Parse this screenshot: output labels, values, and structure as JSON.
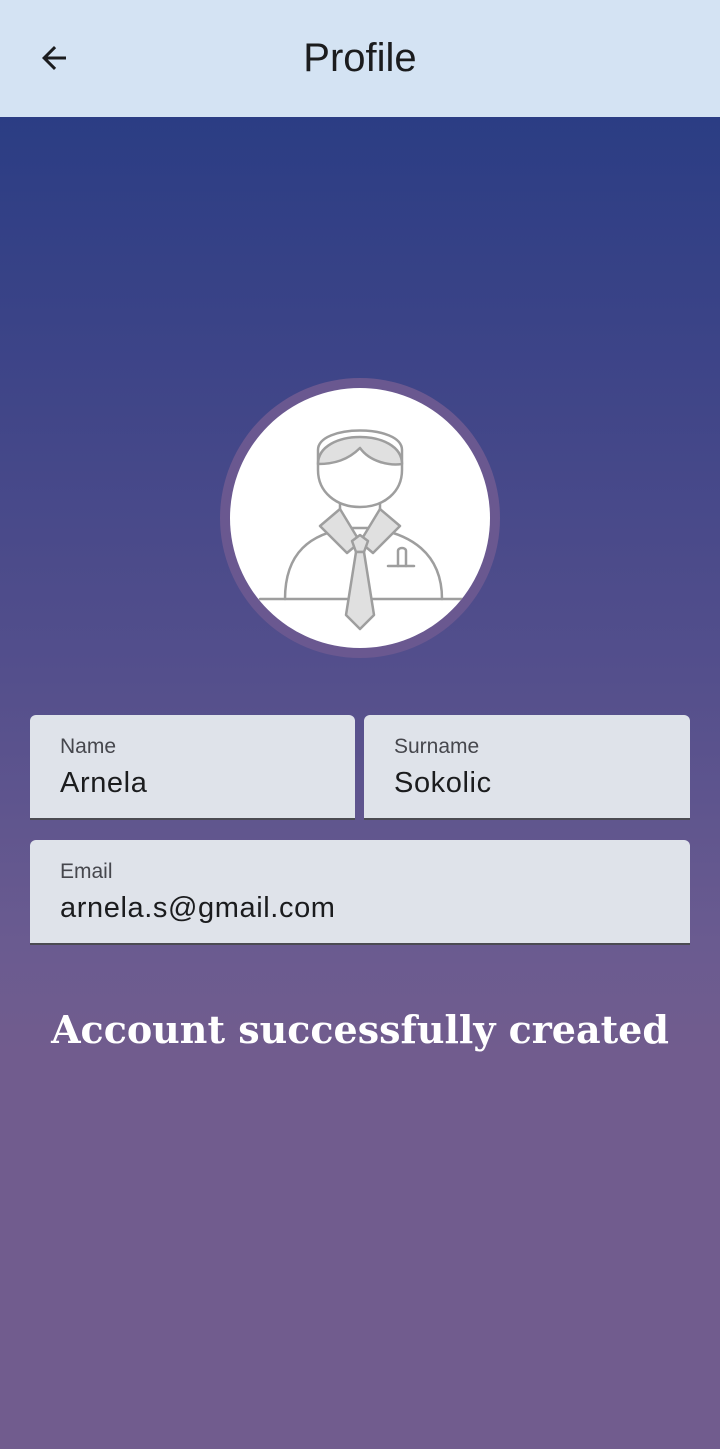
{
  "header": {
    "title": "Profile",
    "back_icon": "arrow-back-icon"
  },
  "profile": {
    "avatar_icon": "person-with-tie-icon",
    "fields": {
      "name": {
        "label": "Name",
        "value": "Arnela"
      },
      "surname": {
        "label": "Surname",
        "value": "Sokolic"
      },
      "email": {
        "label": "Email",
        "value": "arnela.s@gmail.com"
      }
    },
    "status_message": "Account successfully created"
  },
  "colors": {
    "topbar": "#d4e3f3",
    "gradient_top": "#2b3d84",
    "gradient_bottom": "#715c8e",
    "field_bg": "#dfe3ea",
    "avatar_ring": "#6a5890"
  }
}
